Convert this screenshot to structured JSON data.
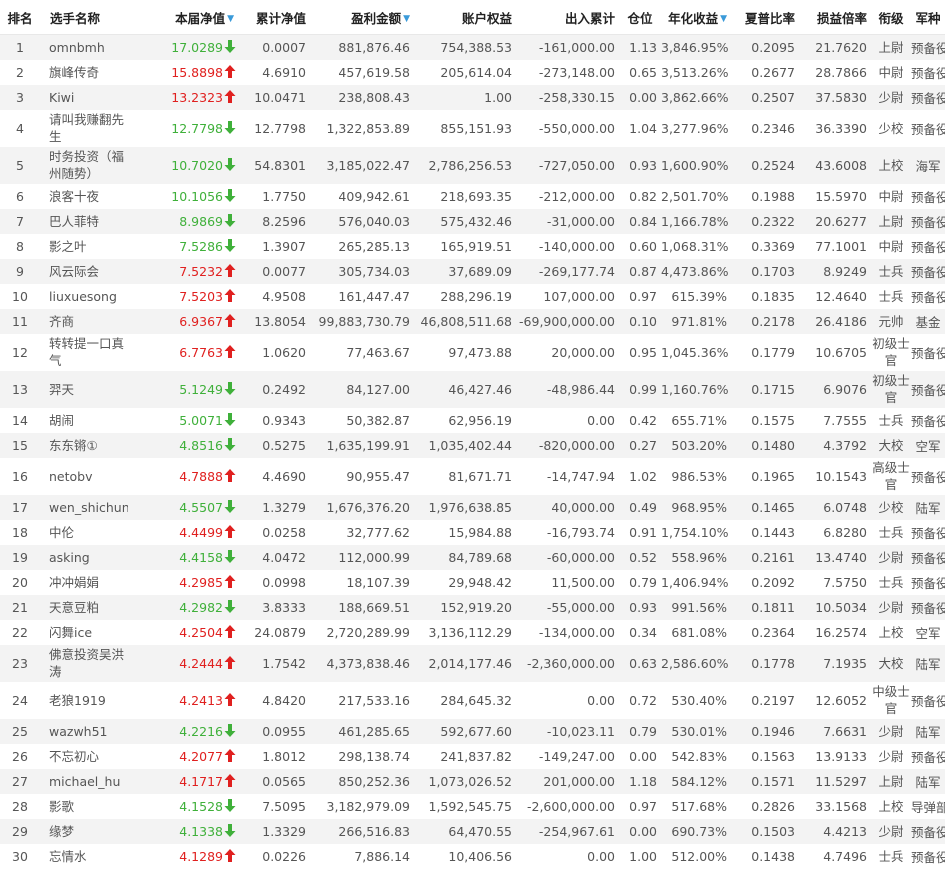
{
  "headers": {
    "rank": "排名",
    "name": "选手名称",
    "nav": "本届净值",
    "cum_nav": "累计净值",
    "profit": "盈利金额",
    "equity": "账户权益",
    "flow": "出入累计",
    "position": "仓位",
    "annual": "年化收益",
    "sharpe": "夏普比率",
    "pl_ratio": "损益倍率",
    "title": "衔级",
    "branch": "军种"
  },
  "colors": {
    "up": "#e0201f",
    "down": "#3fb03a",
    "sort": "#3a9ad9",
    "stripe": "#f3f3f3"
  },
  "rows": [
    {
      "rank": "1",
      "name": "omnbmh",
      "nav": "17.0289",
      "dir": "down",
      "cum": "0.0007",
      "profit": "881,876.46",
      "equity": "754,388.53",
      "flow": "-161,000.00",
      "pos": "1.13",
      "annual": "3,846.95%",
      "sharpe": "0.2095",
      "pl": "21.7620",
      "title": "上尉",
      "branch": "预备役"
    },
    {
      "rank": "2",
      "name": "旗峰传奇",
      "nav": "15.8898",
      "dir": "up",
      "cum": "4.6910",
      "profit": "457,619.58",
      "equity": "205,614.04",
      "flow": "-273,148.00",
      "pos": "0.65",
      "annual": "3,513.26%",
      "sharpe": "0.2677",
      "pl": "28.7866",
      "title": "中尉",
      "branch": "预备役"
    },
    {
      "rank": "3",
      "name": "Kiwi",
      "nav": "13.2323",
      "dir": "up",
      "cum": "10.0471",
      "profit": "238,808.43",
      "equity": "1.00",
      "flow": "-258,330.15",
      "pos": "0.00",
      "annual": "3,862.66%",
      "sharpe": "0.2507",
      "pl": "37.5830",
      "title": "少尉",
      "branch": "预备役"
    },
    {
      "rank": "4",
      "name": "请叫我赚翻先生",
      "nav": "12.7798",
      "dir": "down",
      "cum": "12.7798",
      "profit": "1,322,853.89",
      "equity": "855,151.93",
      "flow": "-550,000.00",
      "pos": "1.04",
      "annual": "3,277.96%",
      "sharpe": "0.2346",
      "pl": "36.3390",
      "title": "少校",
      "branch": "预备役",
      "tall": true
    },
    {
      "rank": "5",
      "name": "时务投资（福州随势）",
      "nav": "10.7020",
      "dir": "down",
      "cum": "54.8301",
      "profit": "3,185,022.47",
      "equity": "2,786,256.53",
      "flow": "-727,050.00",
      "pos": "0.93",
      "annual": "1,600.90%",
      "sharpe": "0.2524",
      "pl": "43.6008",
      "title": "上校",
      "branch": "海军",
      "tall": true
    },
    {
      "rank": "6",
      "name": "浪客十夜",
      "nav": "10.1056",
      "dir": "down",
      "cum": "1.7750",
      "profit": "409,942.61",
      "equity": "218,693.35",
      "flow": "-212,000.00",
      "pos": "0.82",
      "annual": "2,501.70%",
      "sharpe": "0.1988",
      "pl": "15.5970",
      "title": "中尉",
      "branch": "预备役"
    },
    {
      "rank": "7",
      "name": "巴人菲特",
      "nav": "8.9869",
      "dir": "down",
      "cum": "8.2596",
      "profit": "576,040.03",
      "equity": "575,432.46",
      "flow": "-31,000.00",
      "pos": "0.84",
      "annual": "1,166.78%",
      "sharpe": "0.2322",
      "pl": "20.6277",
      "title": "上尉",
      "branch": "预备役"
    },
    {
      "rank": "8",
      "name": "影之叶",
      "nav": "7.5286",
      "dir": "down",
      "cum": "1.3907",
      "profit": "265,285.13",
      "equity": "165,919.51",
      "flow": "-140,000.00",
      "pos": "0.60",
      "annual": "1,068.31%",
      "sharpe": "0.3369",
      "pl": "77.1001",
      "title": "中尉",
      "branch": "预备役"
    },
    {
      "rank": "9",
      "name": "风云际会",
      "nav": "7.5232",
      "dir": "up",
      "cum": "0.0077",
      "profit": "305,734.03",
      "equity": "37,689.09",
      "flow": "-269,177.74",
      "pos": "0.87",
      "annual": "4,473.86%",
      "sharpe": "0.1703",
      "pl": "8.9249",
      "title": "士兵",
      "branch": "预备役"
    },
    {
      "rank": "10",
      "name": "liuxuesong",
      "nav": "7.5203",
      "dir": "up",
      "cum": "4.9508",
      "profit": "161,447.47",
      "equity": "288,296.19",
      "flow": "107,000.00",
      "pos": "0.97",
      "annual": "615.39%",
      "sharpe": "0.1835",
      "pl": "12.4640",
      "title": "士兵",
      "branch": "预备役"
    },
    {
      "rank": "11",
      "name": "齐商",
      "nav": "6.9367",
      "dir": "up",
      "cum": "13.8054",
      "profit": "99,883,730.79",
      "equity": "46,808,511.68",
      "flow": "-69,900,000.00",
      "pos": "0.10",
      "annual": "971.81%",
      "sharpe": "0.2178",
      "pl": "26.4186",
      "title": "元帅",
      "branch": "基金"
    },
    {
      "rank": "12",
      "name": "转转提一口真气",
      "nav": "6.7763",
      "dir": "up",
      "cum": "1.0620",
      "profit": "77,463.67",
      "equity": "97,473.88",
      "flow": "20,000.00",
      "pos": "0.95",
      "annual": "1,045.36%",
      "sharpe": "0.1779",
      "pl": "10.6705",
      "title": "初级士官",
      "branch": "预备役",
      "tall": true
    },
    {
      "rank": "13",
      "name": "羿天",
      "nav": "5.1249",
      "dir": "down",
      "cum": "0.2492",
      "profit": "84,127.00",
      "equity": "46,427.46",
      "flow": "-48,986.44",
      "pos": "0.99",
      "annual": "1,160.76%",
      "sharpe": "0.1715",
      "pl": "6.9076",
      "title": "初级士官",
      "branch": "预备役",
      "tall": true
    },
    {
      "rank": "14",
      "name": "胡闹",
      "nav": "5.0071",
      "dir": "down",
      "cum": "0.9343",
      "profit": "50,382.87",
      "equity": "62,956.19",
      "flow": "0.00",
      "pos": "0.42",
      "annual": "655.71%",
      "sharpe": "0.1575",
      "pl": "7.7555",
      "title": "士兵",
      "branch": "预备役"
    },
    {
      "rank": "15",
      "name": "东东锵①",
      "nav": "4.8516",
      "dir": "down",
      "cum": "0.5275",
      "profit": "1,635,199.91",
      "equity": "1,035,402.44",
      "flow": "-820,000.00",
      "pos": "0.27",
      "annual": "503.20%",
      "sharpe": "0.1480",
      "pl": "4.3792",
      "title": "大校",
      "branch": "空军"
    },
    {
      "rank": "16",
      "name": "netobv",
      "nav": "4.7888",
      "dir": "up",
      "cum": "4.4690",
      "profit": "90,955.47",
      "equity": "81,671.71",
      "flow": "-14,747.94",
      "pos": "1.02",
      "annual": "986.53%",
      "sharpe": "0.1965",
      "pl": "10.1543",
      "title": "高级士官",
      "branch": "预备役",
      "tall": true
    },
    {
      "rank": "17",
      "name": "wen_shichun",
      "nav": "4.5507",
      "dir": "down",
      "cum": "1.3279",
      "profit": "1,676,376.20",
      "equity": "1,976,638.85",
      "flow": "40,000.00",
      "pos": "0.49",
      "annual": "968.95%",
      "sharpe": "0.1465",
      "pl": "6.0748",
      "title": "少校",
      "branch": "陆军"
    },
    {
      "rank": "18",
      "name": "中伦",
      "nav": "4.4499",
      "dir": "up",
      "cum": "0.0258",
      "profit": "32,777.62",
      "equity": "15,984.88",
      "flow": "-16,793.74",
      "pos": "0.91",
      "annual": "1,754.10%",
      "sharpe": "0.1443",
      "pl": "6.8280",
      "title": "士兵",
      "branch": "预备役"
    },
    {
      "rank": "19",
      "name": "asking",
      "nav": "4.4158",
      "dir": "down",
      "cum": "4.0472",
      "profit": "112,000.99",
      "equity": "84,789.68",
      "flow": "-60,000.00",
      "pos": "0.52",
      "annual": "558.96%",
      "sharpe": "0.2161",
      "pl": "13.4740",
      "title": "少尉",
      "branch": "预备役"
    },
    {
      "rank": "20",
      "name": "冲冲娟娟",
      "nav": "4.2985",
      "dir": "up",
      "cum": "0.0998",
      "profit": "18,107.39",
      "equity": "29,948.42",
      "flow": "11,500.00",
      "pos": "0.79",
      "annual": "1,406.94%",
      "sharpe": "0.2092",
      "pl": "7.5750",
      "title": "士兵",
      "branch": "预备役"
    },
    {
      "rank": "21",
      "name": "天意豆粕",
      "nav": "4.2982",
      "dir": "down",
      "cum": "3.8333",
      "profit": "188,669.51",
      "equity": "152,919.20",
      "flow": "-55,000.00",
      "pos": "0.93",
      "annual": "991.56%",
      "sharpe": "0.1811",
      "pl": "10.5034",
      "title": "少尉",
      "branch": "预备役"
    },
    {
      "rank": "22",
      "name": "闪舞ice",
      "nav": "4.2504",
      "dir": "up",
      "cum": "24.0879",
      "profit": "2,720,289.99",
      "equity": "3,136,112.29",
      "flow": "-134,000.00",
      "pos": "0.34",
      "annual": "681.08%",
      "sharpe": "0.2364",
      "pl": "16.2574",
      "title": "上校",
      "branch": "空军"
    },
    {
      "rank": "23",
      "name": "佛意投资吴洪涛",
      "nav": "4.2444",
      "dir": "up",
      "cum": "1.7542",
      "profit": "4,373,838.46",
      "equity": "2,014,177.46",
      "flow": "-2,360,000.00",
      "pos": "0.63",
      "annual": "2,586.60%",
      "sharpe": "0.1778",
      "pl": "7.1935",
      "title": "大校",
      "branch": "陆军",
      "tall": true
    },
    {
      "rank": "24",
      "name": "老狼1919",
      "nav": "4.2413",
      "dir": "up",
      "cum": "4.8420",
      "profit": "217,533.16",
      "equity": "284,645.32",
      "flow": "0.00",
      "pos": "0.72",
      "annual": "530.40%",
      "sharpe": "0.2197",
      "pl": "12.6052",
      "title": "中级士官",
      "branch": "预备役",
      "tall": true
    },
    {
      "rank": "25",
      "name": "wazwh51",
      "nav": "4.2216",
      "dir": "down",
      "cum": "0.0955",
      "profit": "461,285.65",
      "equity": "592,677.60",
      "flow": "-10,023.11",
      "pos": "0.79",
      "annual": "530.01%",
      "sharpe": "0.1946",
      "pl": "7.6631",
      "title": "少尉",
      "branch": "陆军"
    },
    {
      "rank": "26",
      "name": "不忘初心",
      "nav": "4.2077",
      "dir": "up",
      "cum": "1.8012",
      "profit": "298,138.74",
      "equity": "241,837.82",
      "flow": "-149,247.00",
      "pos": "0.00",
      "annual": "542.83%",
      "sharpe": "0.1563",
      "pl": "13.9133",
      "title": "少尉",
      "branch": "预备役"
    },
    {
      "rank": "27",
      "name": "michael_hu",
      "nav": "4.1717",
      "dir": "up",
      "cum": "0.0565",
      "profit": "850,252.36",
      "equity": "1,073,026.52",
      "flow": "201,000.00",
      "pos": "1.18",
      "annual": "584.12%",
      "sharpe": "0.1571",
      "pl": "11.5297",
      "title": "上尉",
      "branch": "陆军"
    },
    {
      "rank": "28",
      "name": "影歌",
      "nav": "4.1528",
      "dir": "down",
      "cum": "7.5095",
      "profit": "3,182,979.09",
      "equity": "1,592,545.75",
      "flow": "-2,600,000.00",
      "pos": "0.97",
      "annual": "517.68%",
      "sharpe": "0.2826",
      "pl": "33.1568",
      "title": "上校",
      "branch": "导弹部队"
    },
    {
      "rank": "29",
      "name": "缘梦",
      "nav": "4.1338",
      "dir": "down",
      "cum": "1.3329",
      "profit": "266,516.83",
      "equity": "64,470.55",
      "flow": "-254,967.61",
      "pos": "0.00",
      "annual": "690.73%",
      "sharpe": "0.1503",
      "pl": "4.4213",
      "title": "少尉",
      "branch": "预备役"
    },
    {
      "rank": "30",
      "name": "忘情水",
      "nav": "4.1289",
      "dir": "up",
      "cum": "0.0226",
      "profit": "7,886.14",
      "equity": "10,406.56",
      "flow": "0.00",
      "pos": "1.00",
      "annual": "512.00%",
      "sharpe": "0.1438",
      "pl": "4.7496",
      "title": "士兵",
      "branch": "预备役"
    }
  ]
}
